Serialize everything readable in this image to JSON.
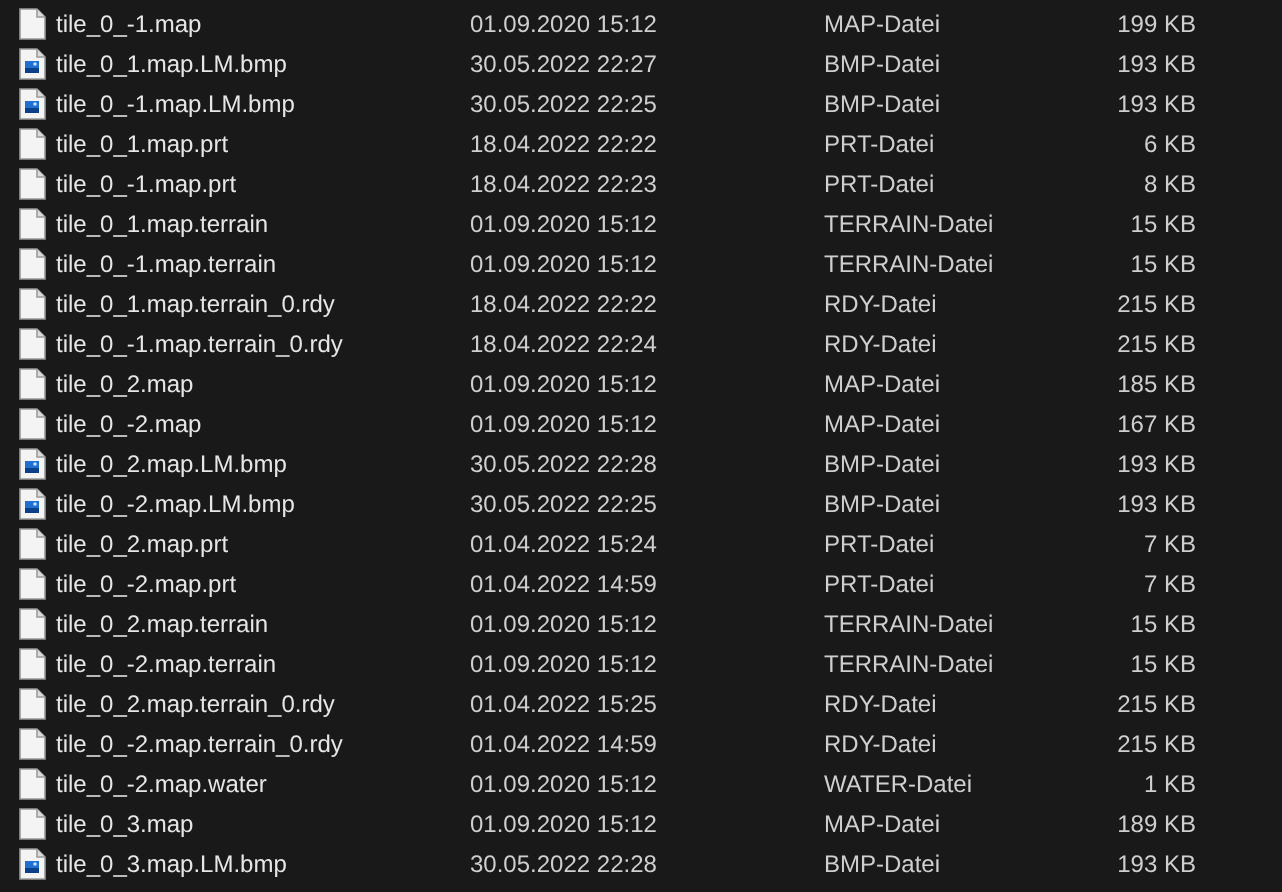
{
  "files": [
    {
      "name": "tile_0_-1.map",
      "modified": "01.09.2020 15:12",
      "type": "MAP-Datei",
      "size": "199 KB",
      "kind": "document"
    },
    {
      "name": "tile_0_1.map.LM.bmp",
      "modified": "30.05.2022 22:27",
      "type": "BMP-Datei",
      "size": "193 KB",
      "kind": "image"
    },
    {
      "name": "tile_0_-1.map.LM.bmp",
      "modified": "30.05.2022 22:25",
      "type": "BMP-Datei",
      "size": "193 KB",
      "kind": "image"
    },
    {
      "name": "tile_0_1.map.prt",
      "modified": "18.04.2022 22:22",
      "type": "PRT-Datei",
      "size": "6 KB",
      "kind": "document"
    },
    {
      "name": "tile_0_-1.map.prt",
      "modified": "18.04.2022 22:23",
      "type": "PRT-Datei",
      "size": "8 KB",
      "kind": "document"
    },
    {
      "name": "tile_0_1.map.terrain",
      "modified": "01.09.2020 15:12",
      "type": "TERRAIN-Datei",
      "size": "15 KB",
      "kind": "document"
    },
    {
      "name": "tile_0_-1.map.terrain",
      "modified": "01.09.2020 15:12",
      "type": "TERRAIN-Datei",
      "size": "15 KB",
      "kind": "document"
    },
    {
      "name": "tile_0_1.map.terrain_0.rdy",
      "modified": "18.04.2022 22:22",
      "type": "RDY-Datei",
      "size": "215 KB",
      "kind": "document"
    },
    {
      "name": "tile_0_-1.map.terrain_0.rdy",
      "modified": "18.04.2022 22:24",
      "type": "RDY-Datei",
      "size": "215 KB",
      "kind": "document"
    },
    {
      "name": "tile_0_2.map",
      "modified": "01.09.2020 15:12",
      "type": "MAP-Datei",
      "size": "185 KB",
      "kind": "document"
    },
    {
      "name": "tile_0_-2.map",
      "modified": "01.09.2020 15:12",
      "type": "MAP-Datei",
      "size": "167 KB",
      "kind": "document"
    },
    {
      "name": "tile_0_2.map.LM.bmp",
      "modified": "30.05.2022 22:28",
      "type": "BMP-Datei",
      "size": "193 KB",
      "kind": "image"
    },
    {
      "name": "tile_0_-2.map.LM.bmp",
      "modified": "30.05.2022 22:25",
      "type": "BMP-Datei",
      "size": "193 KB",
      "kind": "image"
    },
    {
      "name": "tile_0_2.map.prt",
      "modified": "01.04.2022 15:24",
      "type": "PRT-Datei",
      "size": "7 KB",
      "kind": "document"
    },
    {
      "name": "tile_0_-2.map.prt",
      "modified": "01.04.2022 14:59",
      "type": "PRT-Datei",
      "size": "7 KB",
      "kind": "document"
    },
    {
      "name": "tile_0_2.map.terrain",
      "modified": "01.09.2020 15:12",
      "type": "TERRAIN-Datei",
      "size": "15 KB",
      "kind": "document"
    },
    {
      "name": "tile_0_-2.map.terrain",
      "modified": "01.09.2020 15:12",
      "type": "TERRAIN-Datei",
      "size": "15 KB",
      "kind": "document"
    },
    {
      "name": "tile_0_2.map.terrain_0.rdy",
      "modified": "01.04.2022 15:25",
      "type": "RDY-Datei",
      "size": "215 KB",
      "kind": "document"
    },
    {
      "name": "tile_0_-2.map.terrain_0.rdy",
      "modified": "01.04.2022 14:59",
      "type": "RDY-Datei",
      "size": "215 KB",
      "kind": "document"
    },
    {
      "name": "tile_0_-2.map.water",
      "modified": "01.09.2020 15:12",
      "type": "WATER-Datei",
      "size": "1 KB",
      "kind": "document"
    },
    {
      "name": "tile_0_3.map",
      "modified": "01.09.2020 15:12",
      "type": "MAP-Datei",
      "size": "189 KB",
      "kind": "document"
    },
    {
      "name": "tile_0_3.map.LM.bmp",
      "modified": "30.05.2022 22:28",
      "type": "BMP-Datei",
      "size": "193 KB",
      "kind": "image"
    }
  ]
}
